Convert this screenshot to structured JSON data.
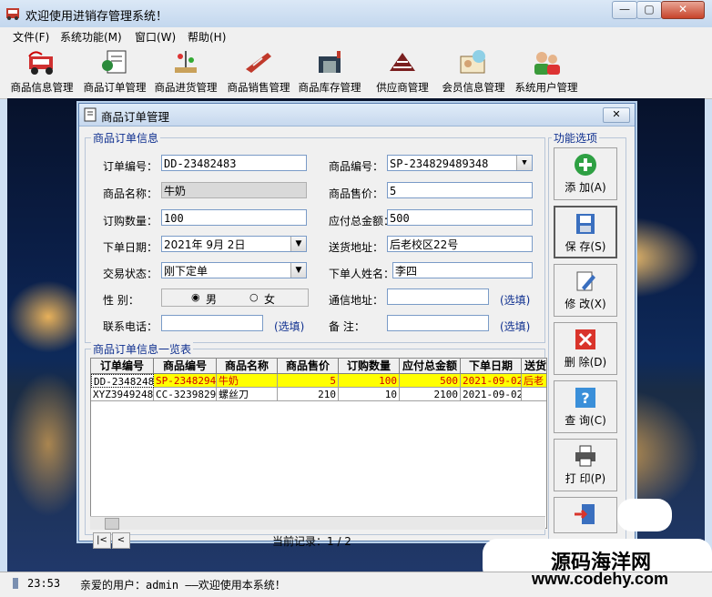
{
  "window": {
    "title": "欢迎使用进销存管理系统！"
  },
  "menu": [
    "文件(F)",
    "系统功能(M)",
    "窗口(W)",
    "帮助(H)"
  ],
  "toolbar": [
    {
      "label": "商品信息管理",
      "icon": "truck-icon"
    },
    {
      "label": "商品订单管理",
      "icon": "order-book-icon"
    },
    {
      "label": "商品进货管理",
      "icon": "stock-in-icon"
    },
    {
      "label": "商品销售管理",
      "icon": "knife-icon"
    },
    {
      "label": "商品库存管理",
      "icon": "warehouse-icon"
    },
    {
      "label": "供应商管理",
      "icon": "supplier-icon"
    },
    {
      "label": "会员信息管理",
      "icon": "member-card-icon"
    },
    {
      "label": "系统用户管理",
      "icon": "users-icon"
    }
  ],
  "child": {
    "title": "商品订单管理",
    "close": "✕",
    "form": {
      "legend": "商品订单信息",
      "order_no_label": "订单编号：",
      "order_no": "DD-23482483",
      "product_no_label": "商品编号：",
      "product_no": "SP-234829489348",
      "product_name_label": "商品名称：",
      "product_name": "牛奶",
      "price_label": "商品售价：",
      "price": "5",
      "qty_label": "订购数量：",
      "qty": "100",
      "total_label": "应付总金额：",
      "total": "500",
      "date_label": "下单日期：",
      "date": "2021年 9月 2日",
      "address_label": "送货地址：",
      "address": "后老校区22号",
      "status_label": "交易状态：",
      "status": "刚下定单",
      "buyer_label": "下单人姓名：",
      "buyer": "李四",
      "gender_label": "性    别：",
      "male": "男",
      "female": "女",
      "mail_addr_label": "通信地址：",
      "mail_addr": "",
      "phone_label": "联系电话：",
      "phone": "",
      "remark_label": "备    注：",
      "remark": "",
      "optional": "(选填)"
    },
    "list": {
      "legend": "商品订单信息一览表",
      "columns": [
        "订单编号",
        "商品编号",
        "商品名称",
        "商品售价",
        "订购数量",
        "应付总金额",
        "下单日期",
        "送货"
      ],
      "rows": [
        [
          "DD-23482483",
          "SP-2348294",
          "牛奶",
          "5",
          "100",
          "500",
          "2021-09-02",
          "后老"
        ],
        [
          "XYZ3949248",
          "CC-3239829",
          "螺丝刀",
          "210",
          "10",
          "2100",
          "2021-09-02",
          ""
        ]
      ],
      "record_text": "当前记录：1 / 2"
    },
    "functions": {
      "legend": "功能选项",
      "add": "添 加(A)",
      "save": "保 存(S)",
      "edit": "修 改(X)",
      "delete": "删 除(D)",
      "query": "查 询(C)",
      "print": "打 印(P)"
    }
  },
  "status": {
    "time": "23:53",
    "message": "亲爱的用户：admin ——欢迎使用本系统！"
  },
  "watermark": {
    "line1": "源码海洋网",
    "line2": "www.codehy.com"
  }
}
